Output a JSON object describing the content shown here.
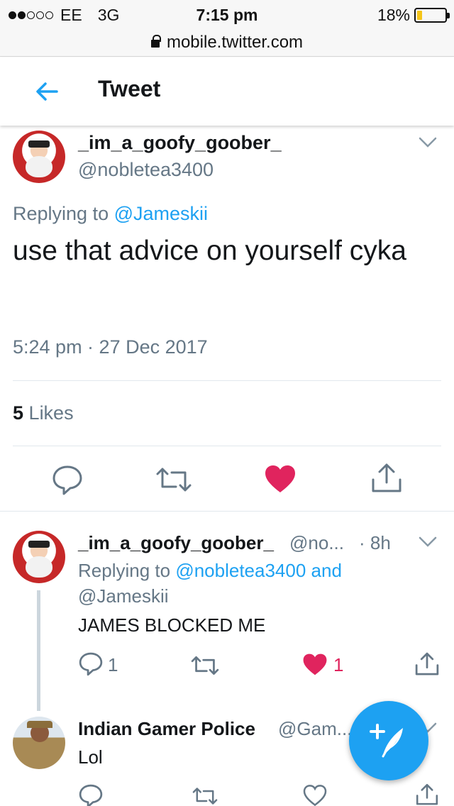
{
  "status_bar": {
    "carrier": "EE",
    "network": "3G",
    "time": "7:15 pm",
    "battery": "18%",
    "battery_level": 0.18,
    "signal_bars_filled": 2,
    "signal_bars_total": 5
  },
  "browser": {
    "url": "mobile.twitter.com"
  },
  "header": {
    "title": "Tweet",
    "back_icon": "arrow-left-icon"
  },
  "tweet": {
    "display_name": "_im_a_goofy_goober_",
    "handle": "@nobletea3400",
    "replying_prefix": "Replying to",
    "replying_to": "@Jameskii",
    "text": "use that advice on yourself cyka",
    "timestamp": "5:24 pm · 27 Dec 2017",
    "likes_count": "5",
    "likes_label": "Likes"
  },
  "replies": [
    {
      "display_name": "_im_a_goofy_goober_",
      "handle": "@no...",
      "age": "· 8h",
      "replying_prefix": "Replying to",
      "replying_to": "@nobletea3400 and",
      "replying_to_2": "@Jameskii",
      "text": "JAMES BLOCKED ME",
      "reply_count": "1",
      "like_count": "1",
      "liked": true
    },
    {
      "display_name": "Indian Gamer Police",
      "handle": "@Gam...",
      "text": "Lol",
      "liked": false
    }
  ],
  "colors": {
    "accent": "#1da1f2",
    "like": "#e0245e",
    "muted": "#657786",
    "battery": "#f5c518"
  }
}
